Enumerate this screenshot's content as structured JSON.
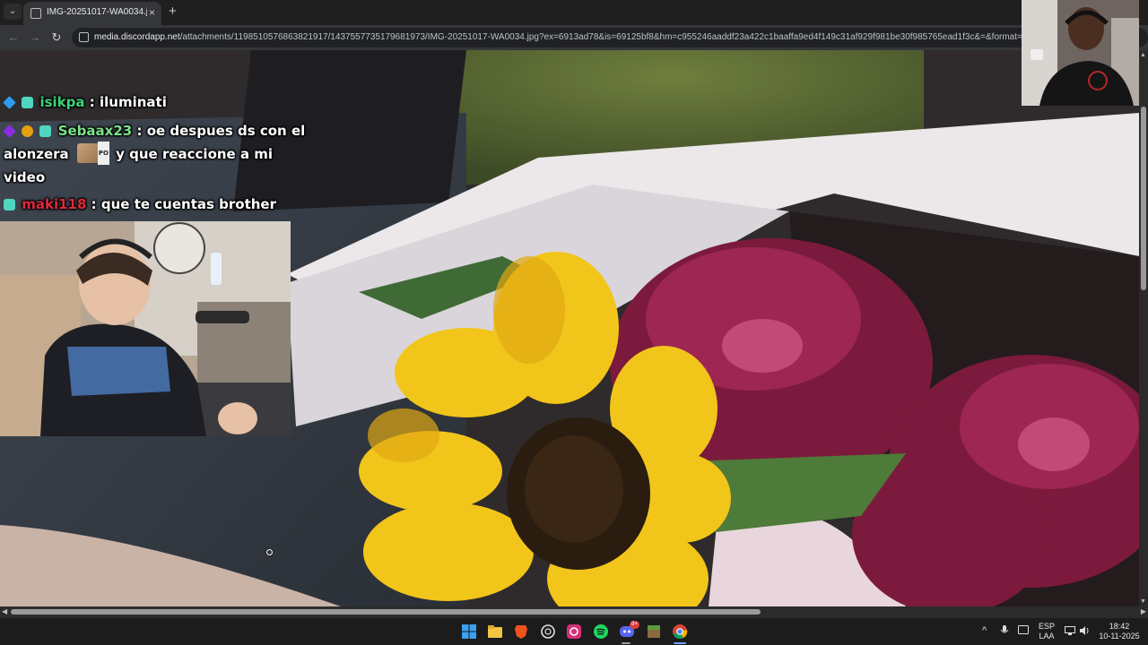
{
  "browser": {
    "tab_title": "IMG-20251017-WA0034.jpg (9…",
    "tab_close": "×",
    "new_tab": "+",
    "tab_menu": "⌄",
    "url_host": "media.discordapp.net",
    "url_path": "/attachments/1198510576863821917/1437557735179681973/IMG-20251017-WA0034.jpg?ex=6913ad78&is=69125bf8&hm=c955246aaddf23a422c1baaffa9ed4f149c31af929f981be30f985765ead1f3c&=&format=webp&width=96",
    "nav_back": "←",
    "nav_forward": "→",
    "nav_reload": "↻"
  },
  "chat": {
    "messages": [
      {
        "user": "isikpa",
        "sep": ":",
        "text": "iluminati"
      },
      {
        "user": "Sebaax23",
        "sep": ":",
        "text": "oe despues ds con el",
        "text2": "alonzera",
        "text3": "y que reaccione a mi",
        "text4": "video"
      },
      {
        "user": "maki118",
        "sep": ":",
        "text": "que te cuentas brother"
      }
    ],
    "emote_tag": "PO"
  },
  "taskbar": {
    "language": "ESP",
    "layout": "LAA",
    "time": "18:42",
    "date": "10-11-2025",
    "discord_badge": "9+",
    "tray_chevron": "^"
  },
  "colors": {
    "user_isikpa": "#3fd37a",
    "user_sebaax23": "#7be38a",
    "user_maki118": "#e0283a"
  }
}
